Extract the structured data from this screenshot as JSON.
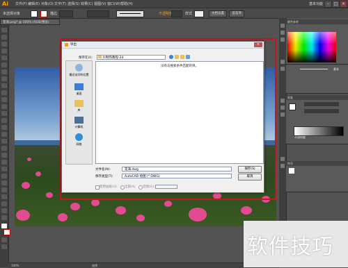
{
  "app": {
    "logo": "Ai"
  },
  "menubar": {
    "items": [
      "文件(F)",
      "编辑(E)",
      "对象(O)",
      "文字(T)",
      "选择(S)",
      "效果(C)",
      "视图(V)",
      "窗口(W)",
      "帮助(H)"
    ],
    "workspace": "基本功能"
  },
  "controlbar": {
    "selection_label": "未选择对象",
    "stroke_label": "描边",
    "style_label": "样式",
    "opacity_label": "不透明度",
    "doc_setup_label": "文档设置",
    "preferences_label": "首选项"
  },
  "document": {
    "tab_label": "花海.png* @ 100% (RGB/预览)"
  },
  "dialog": {
    "title": "导出",
    "save_in_label": "保存在(I):",
    "save_in_value": "fc制作教程-2d",
    "empty_message": "没有与搜索条件匹配的项。",
    "places": [
      "最近访问的位置",
      "桌面",
      "库",
      "计算机",
      "网络"
    ],
    "filename_label": "文件名(N):",
    "filename_value": "花海.dwg",
    "filetype_label": "保存类型(T):",
    "filetype_value": "AutoCAD 绘图 (*.DWG)",
    "save_button": "保存(S)",
    "cancel_button": "取消",
    "option_artboards": "使用画板(U)",
    "option_all": "全部(A)",
    "option_range": "范围(G):"
  },
  "panels": {
    "color": "颜色参考",
    "brush_label": "基本",
    "transparency": "不透明度",
    "gradient": "渐变",
    "symbols": "符号"
  },
  "statusbar": {
    "zoom": "100%",
    "tool": "选择"
  },
  "watermark": "软件技巧",
  "colors": {
    "accent": "#ff9a00",
    "frame": "#c4161c",
    "flower": "#e14b92"
  }
}
